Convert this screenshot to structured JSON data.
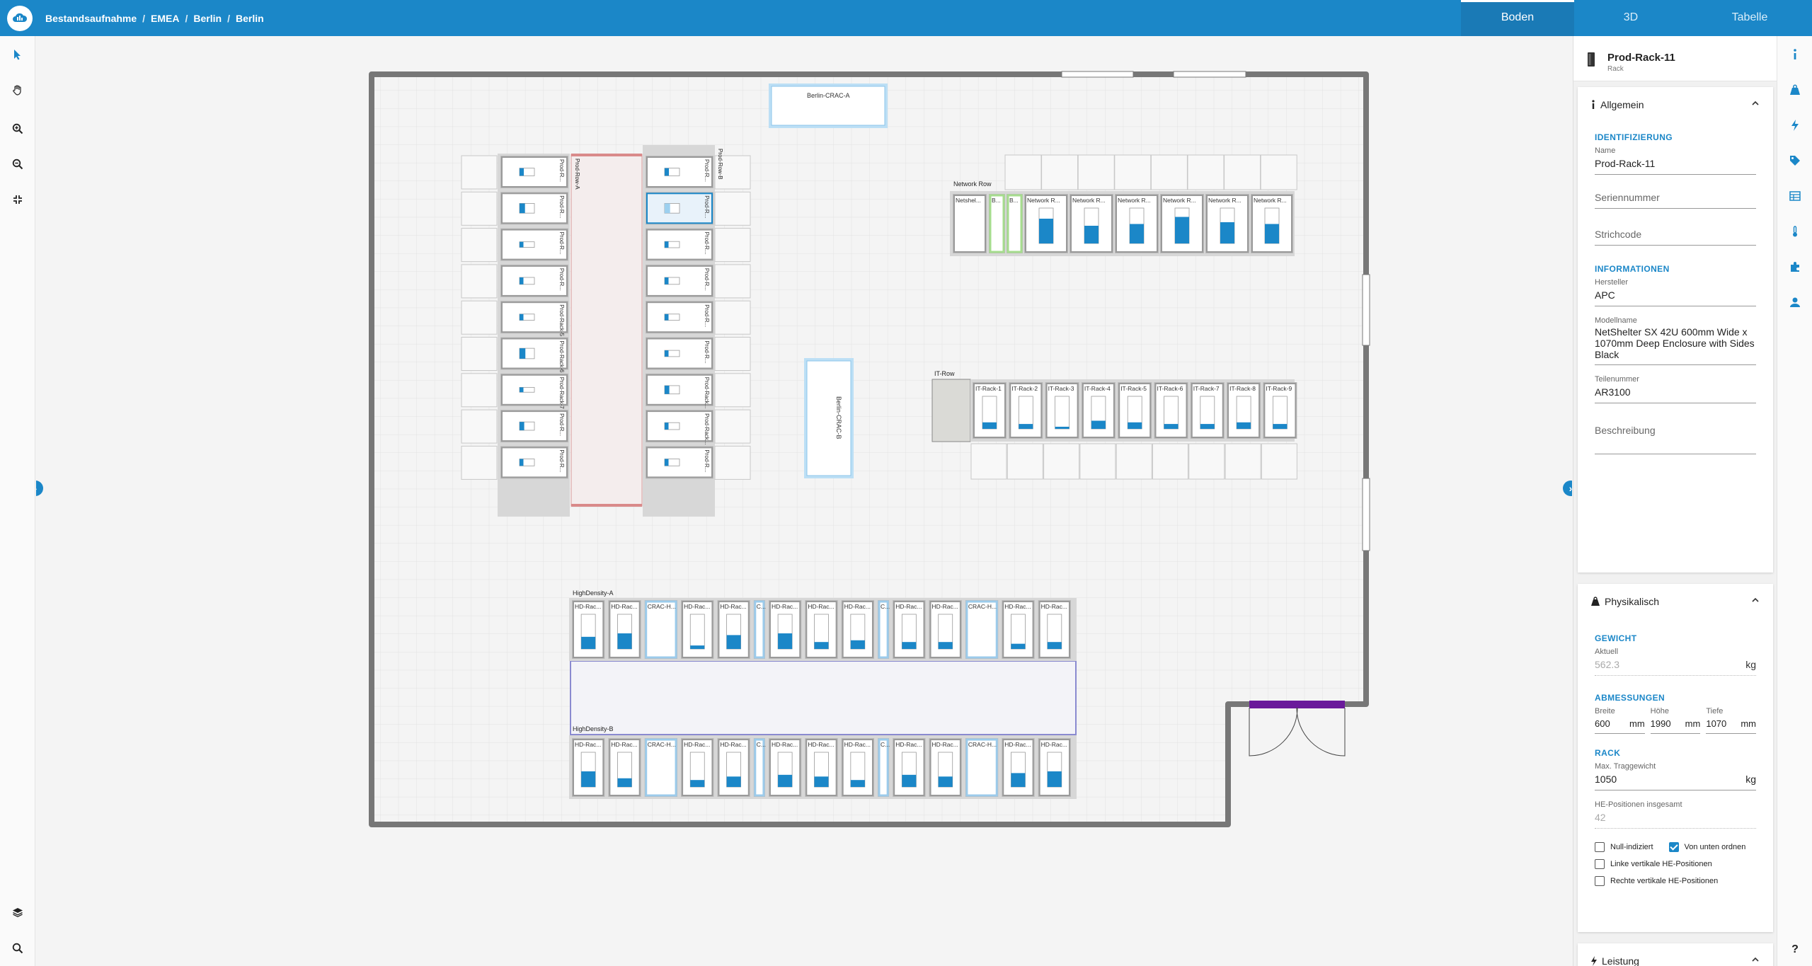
{
  "breadcrumbs": [
    "Bestandsaufnahme",
    "EMEA",
    "Berlin",
    "Berlin"
  ],
  "view_tabs": [
    "Boden",
    "3D",
    "Tabelle"
  ],
  "active_view": "Boden",
  "left_tools": [
    "cursor-icon",
    "hand-icon",
    "zoom-in-icon",
    "zoom-out-icon",
    "fit-icon"
  ],
  "left_bottom_tools": [
    "layers-icon",
    "search-icon"
  ],
  "right_tools": [
    "info-icon",
    "weight-icon",
    "power-icon",
    "tag-icon",
    "table-icon",
    "temperature-icon",
    "plugin-icon",
    "user-icon"
  ],
  "help_label": "?",
  "floor": {
    "crac_a": "Berlin-CRAC-A",
    "crac_b": "Berlin-CRAC-B",
    "row_a_label": "Prod-Row-A",
    "row_b_label": "Prod-Row-B",
    "row_a": [
      "Prod-R...",
      "Prod-R...",
      "Prod-R...",
      "Prod-R...",
      "Prod-Rack-5",
      "Prod-Rack-6",
      "Prod-Rack-7",
      "Prod-R...",
      "Prod-R..."
    ],
    "row_a_fill": [
      0.55,
      0.7,
      0.4,
      0.5,
      0.45,
      0.75,
      0.35,
      0.6,
      0.5
    ],
    "row_b": [
      "Prod-R...",
      "Prod-R...",
      "Prod-R...",
      "Prod-R...",
      "Prod-R...",
      "Prod-R...",
      "Prod-Rack...",
      "Prod-Rack...",
      "Prod-R..."
    ],
    "row_b_fill": [
      0.55,
      0.7,
      0.45,
      0.5,
      0.45,
      0.45,
      0.6,
      0.5,
      0.5
    ],
    "network_row_label": "Network Row",
    "network_row": [
      "Netshel...",
      "B...",
      "B...",
      "Network R...",
      "Network R...",
      "Network R...",
      "Network R...",
      "Network R...",
      "Network R..."
    ],
    "network_fill": [
      0,
      0,
      0,
      0.7,
      0.5,
      0.55,
      0.75,
      0.6,
      0.55
    ],
    "it_row_label": "IT-Row",
    "it_row": [
      "IT-Rack-1",
      "IT-Rack-2",
      "IT-Rack-3",
      "IT-Rack-4",
      "IT-Rack-5",
      "IT-Rack-6",
      "IT-Rack-7",
      "IT-Rack-8",
      "IT-Rack-9"
    ],
    "it_fill": [
      0.2,
      0.15,
      0.05,
      0.25,
      0.2,
      0.15,
      0.15,
      0.2,
      0.15
    ],
    "hd_a_label": "HighDensity-A",
    "hd_a": [
      "HD-Rac...",
      "HD-Rac...",
      "CRAC-H...",
      "HD-Rac...",
      "HD-Rac...",
      "C...",
      "HD-Rac...",
      "HD-Rac...",
      "HD-Rac...",
      "C...",
      "HD-Rac...",
      "HD-Rac...",
      "CRAC-H...",
      "HD-Rac...",
      "HD-Rac..."
    ],
    "hd_a_fill": [
      0.35,
      0.45,
      0,
      0.1,
      0.4,
      0,
      0.45,
      0.2,
      0.25,
      0,
      0.2,
      0.2,
      0,
      0.15,
      0.2
    ],
    "hd_b_label": "HighDensity-B",
    "hd_b": [
      "HD-Rac...",
      "HD-Rac...",
      "CRAC-H...",
      "HD-Rac...",
      "HD-Rac...",
      "C...",
      "HD-Rac...",
      "HD-Rac...",
      "HD-Rac...",
      "C...",
      "HD-Rac...",
      "HD-Rac...",
      "CRAC-H...",
      "HD-Rac...",
      "HD-Rac..."
    ],
    "hd_b_fill": [
      0.45,
      0.25,
      0,
      0.2,
      0.3,
      0,
      0.35,
      0.3,
      0.2,
      0,
      0.35,
      0.3,
      0,
      0.4,
      0.45
    ]
  },
  "panel": {
    "title": "Prod-Rack-11",
    "subtitle": "Rack",
    "general": {
      "header": "Allgemein",
      "ident_header": "IDENTIFIZIERUNG",
      "name_label": "Name",
      "name_value": "Prod-Rack-11",
      "serial_placeholder": "Seriennummer",
      "barcode_placeholder": "Strichcode",
      "info_header": "INFORMATIONEN",
      "manufacturer_label": "Hersteller",
      "manufacturer_value": "APC",
      "model_label": "Modellname",
      "model_value": "NetShelter SX 42U 600mm Wide x 1070mm Deep Enclosure with Sides Black",
      "part_label": "Teilenummer",
      "part_value": "AR3100",
      "description_placeholder": "Beschreibung"
    },
    "physical": {
      "header": "Physikalisch",
      "weight_header": "GEWICHT",
      "current_label": "Aktuell",
      "current_value": "562.3",
      "weight_unit": "kg",
      "dims_header": "ABMESSUNGEN",
      "width_label": "Breite",
      "width_value": "600",
      "height_label": "Höhe",
      "height_value": "1990",
      "depth_label": "Tiefe",
      "depth_value": "1070",
      "mm": "mm",
      "rack_header": "RACK",
      "max_label": "Max. Traggewicht",
      "max_value": "1050",
      "he_label": "HE-Positionen insgesamt",
      "he_value": "42",
      "cb_null": "Null-indiziert",
      "cb_bottom": "Von unten ordnen",
      "cb_left": "Linke vertikale HE-Positionen",
      "cb_right": "Rechte vertikale HE-Positionen"
    },
    "power": {
      "header": "Leistung"
    }
  }
}
